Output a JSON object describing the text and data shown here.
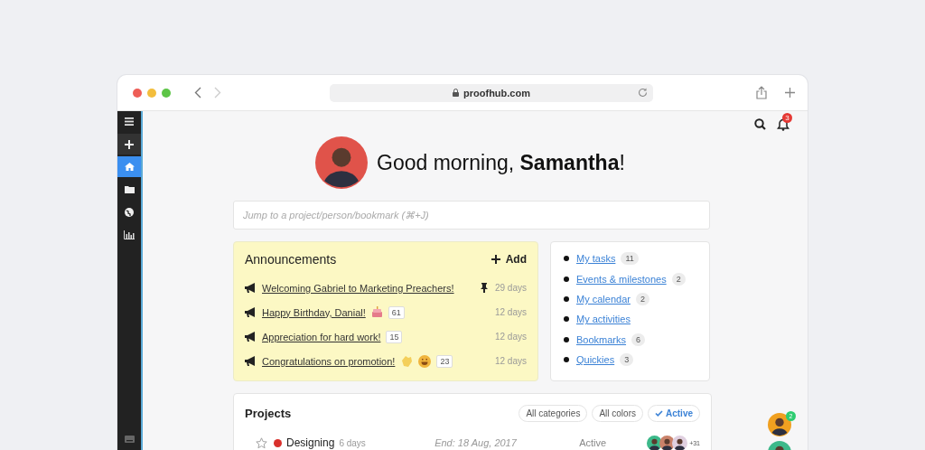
{
  "browser": {
    "url": "proofhub.com"
  },
  "sidebar": {
    "items": [
      {
        "kind": "menu",
        "selected": false
      },
      {
        "kind": "add",
        "selected": false
      },
      {
        "kind": "home",
        "selected": true
      },
      {
        "kind": "folder",
        "selected": false
      },
      {
        "kind": "globe",
        "selected": false
      },
      {
        "kind": "chart",
        "selected": false
      }
    ]
  },
  "header": {
    "notifications": "3"
  },
  "greeting": "Good morning, **Samantha**!",
  "search": {
    "placeholder": "Jump to a project/person/bookmark (⌘+J)"
  },
  "announcements": {
    "title": "Announcements",
    "add_label": "Add",
    "items": [
      {
        "title": "Welcoming Gabriel to Marketing Preachers!",
        "pinned": true,
        "age": "29 days"
      },
      {
        "title": "Happy Birthday, Danial!",
        "pinned": false,
        "reactions": [
          {
            "kind": "cake"
          }
        ],
        "count": "61",
        "age": "12 days"
      },
      {
        "title": "Appreciation for hard work!",
        "pinned": false,
        "count": "15",
        "age": "12 days"
      },
      {
        "title": "Congratulations on promotion!",
        "pinned": false,
        "reactions": [
          {
            "kind": "clap"
          },
          {
            "kind": "grin"
          }
        ],
        "count": "23",
        "age": "12 days"
      }
    ]
  },
  "quick_links": [
    {
      "label": "My tasks",
      "count": "11"
    },
    {
      "label": "Events & milestones",
      "count": "2"
    },
    {
      "label": "My calendar",
      "count": "2"
    },
    {
      "label": "My activities"
    },
    {
      "label": "Bookmarks",
      "count": "6"
    },
    {
      "label": "Quickies",
      "count": "3"
    }
  ],
  "projects": {
    "title": "Projects",
    "filters": [
      {
        "label": "All categories",
        "selected": false
      },
      {
        "label": "All colors",
        "selected": false
      },
      {
        "label": "Active",
        "selected": true
      }
    ],
    "rows": [
      {
        "starred": false,
        "color": "#d9302c",
        "name": "Designing",
        "duration": "6 days",
        "end": "End: 18 Aug, 2017",
        "status": "Active",
        "more_members": "+31"
      }
    ]
  },
  "chat": {
    "unread": "2"
  }
}
